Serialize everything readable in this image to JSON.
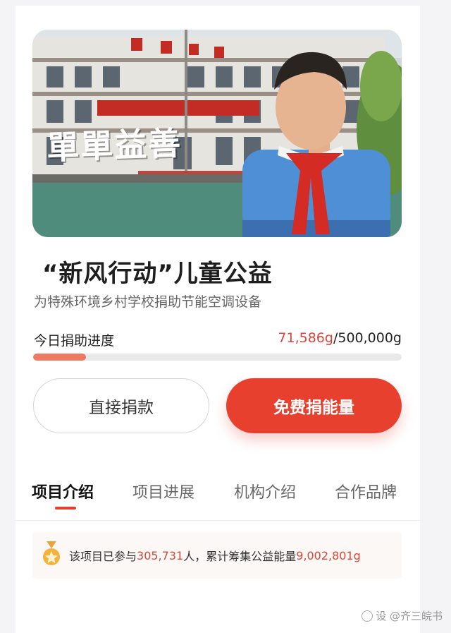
{
  "banner": {
    "logo_text": "單單益善",
    "image_alt": "boy with red scarf in front of school building"
  },
  "project": {
    "title": "“新风行动”儿童公益",
    "subtitle": "为特殊环境乡村学校捐助节能空调设备"
  },
  "progress": {
    "label": "今日捐助进度",
    "current": "71,586g",
    "separator": "/",
    "target": "500,000g",
    "fraction": 0.143
  },
  "actions": {
    "direct_donate": "直接捐款",
    "free_energy": "免费捐能量"
  },
  "tabs": [
    {
      "label": "项目介绍",
      "active": true
    },
    {
      "label": "项目进展",
      "active": false
    },
    {
      "label": "机构介绍",
      "active": false
    },
    {
      "label": "合作品牌",
      "active": false
    }
  ],
  "stats": {
    "prefix": "该项目已参与",
    "participants": "305,731",
    "middle": "人，累计筹集公益能量",
    "energy": "9,002,801g"
  },
  "watermark": {
    "text": "设 @齐三皖书"
  },
  "colors": {
    "accent": "#e8402f",
    "highlight_text": "#d9463a",
    "progress_fill": "#f07a5f"
  }
}
